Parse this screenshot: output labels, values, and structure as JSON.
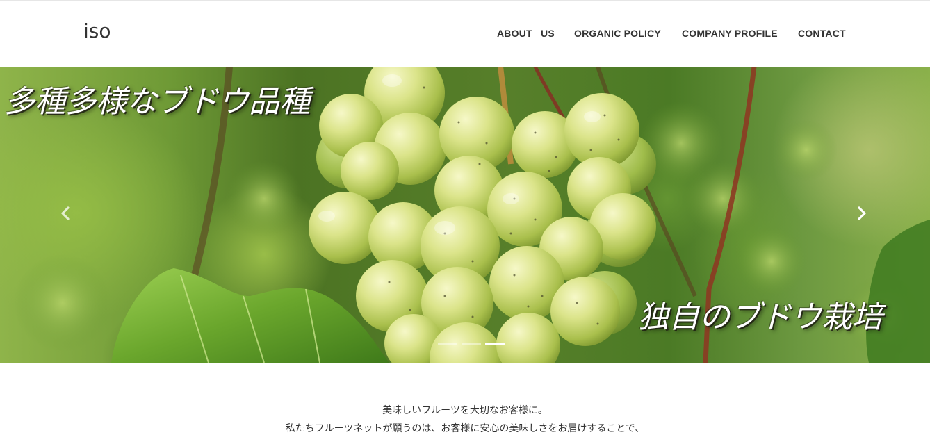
{
  "site": {
    "logo": "iso"
  },
  "nav": {
    "items": [
      {
        "label": "ABOUT   US"
      },
      {
        "label": "ORGANIC POLICY"
      },
      {
        "label": "COMPANY PROFILE"
      },
      {
        "label": "CONTACT"
      }
    ]
  },
  "hero": {
    "caption_top": "多種多様なブドウ品種",
    "caption_bottom": "独自のブドウ栽培",
    "prev_icon": "chevron-left-icon",
    "next_icon": "chevron-right-icon",
    "slides_count": 3,
    "active_slide": 3
  },
  "intro": {
    "line1": "美味しいフルーツを大切なお客様に。",
    "line2": "私たちフルーツネットが願うのは、お客様に安心の美味しさをお届けすることで、"
  }
}
